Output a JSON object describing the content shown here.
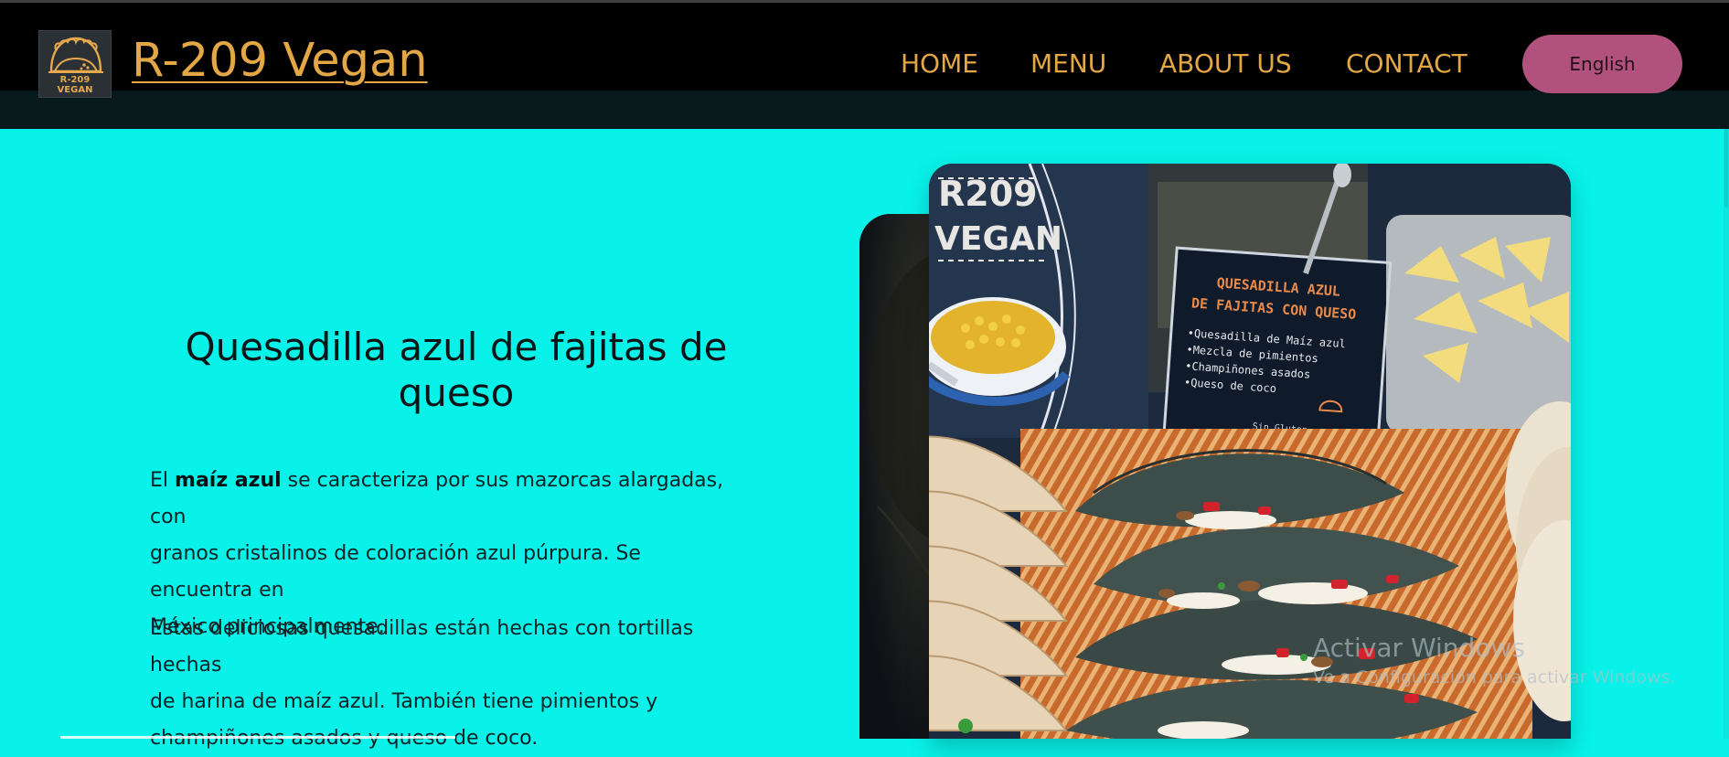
{
  "header": {
    "logo_line1": "R-209",
    "logo_line2": "VEGAN",
    "site_title": "R-209 Vegan",
    "nav": [
      "HOME",
      "MENU",
      "ABOUT US",
      "CONTACT"
    ],
    "language_button": "English"
  },
  "main": {
    "dish_title_line1": "Quesadilla azul de fajitas de",
    "dish_title_line2": "queso",
    "para1_prefix": "El ",
    "para1_bold": "maíz azul",
    "para1_rest": " se caracteriza por sus mazorcas alargadas, con",
    "para1_line2": "granos cristalinos de coloración azul púrpura. Se encuentra en",
    "para1_line3": "México principalmente.",
    "para2_line1": "Estas deliciosas quesadillas están hechas con tortillas hechas",
    "para2_line2": "de harina de maíz azul. También tiene pimientos y",
    "para2_line3": "champiñones asados y queso de coco."
  },
  "photo": {
    "board_line1": "R209",
    "board_line2": "VEGAN",
    "sign_title_line1": "QUESADILLA AZUL",
    "sign_title_line2": "DE FAJITAS CON QUESO",
    "sign_items": [
      "•Quesadilla de Maíz azul",
      "•Mezcla de pimientos",
      "•Champiñones asados",
      "•Queso de coco"
    ],
    "sign_footer": "Sin Gluten"
  },
  "watermark": {
    "line1": "Activar Windows",
    "line2": "Ve a Configuración para activar Windows."
  },
  "colors": {
    "page_background": "#08f2e9",
    "header_background": "#000000",
    "accent_gold": "#e4a746",
    "language_button": "#b0527d"
  },
  "icons": {
    "logo": "taco-logo-icon"
  }
}
